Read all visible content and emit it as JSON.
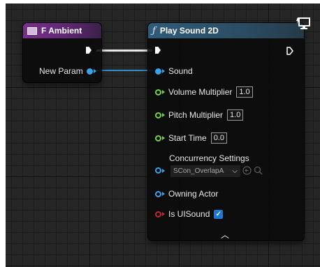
{
  "ambient_node": {
    "title": "F Ambient",
    "output_label": "New Param"
  },
  "play_node": {
    "title": "Play Sound 2D",
    "pins": {
      "sound": "Sound",
      "volume": {
        "label": "Volume Multiplier",
        "value": "1.0"
      },
      "pitch": {
        "label": "Pitch Multiplier",
        "value": "1.0"
      },
      "start_time": {
        "label": "Start Time",
        "value": "0.0"
      },
      "concurrency": {
        "label": "Concurrency Settings",
        "value": "SCon_OverlapA"
      },
      "owning_actor": "Owning Actor",
      "is_ui_sound": {
        "label": "Is UISound",
        "checked": true
      }
    }
  },
  "icons": {
    "variable": "variable-icon",
    "function": "function-icon",
    "monitor": "monitor-icon",
    "browse": "browse-arrow-icon",
    "search": "search-icon",
    "collapse": "chevron-up-icon",
    "checkmark": "check-icon"
  },
  "colors": {
    "grid_background": "#262626",
    "variable_header": "#7a2f8c",
    "function_header": "#2f5c79",
    "object_pin": "#3aa3e8",
    "float_pin": "#73d14a",
    "bool_pin": "#c0282d",
    "checkbox": "#1f78d0"
  }
}
